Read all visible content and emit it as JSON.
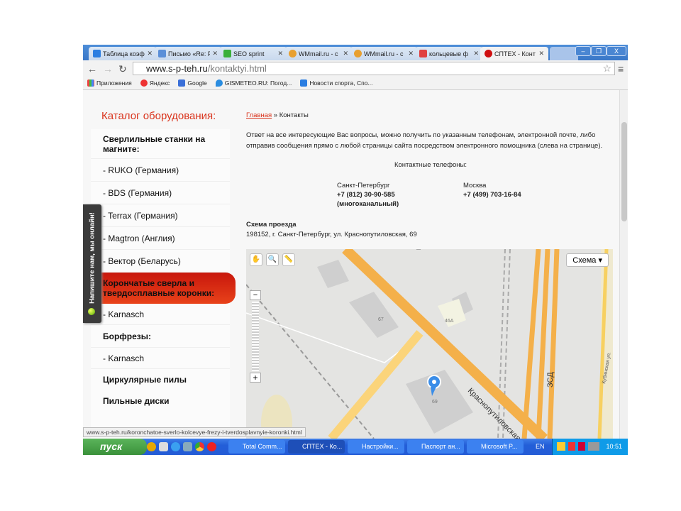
{
  "browser": {
    "tabs": [
      {
        "label": "Таблица коэф",
        "color": "#2a7de1"
      },
      {
        "label": "Письмо «Re: F",
        "color": "#5b8fd8"
      },
      {
        "label": "SEO sprint",
        "color": "#3ab03a"
      },
      {
        "label": "WMmail.ru - с",
        "color": "#e8a030"
      },
      {
        "label": "WMmail.ru - с",
        "color": "#e8a030"
      },
      {
        "label": "кольцевые ф",
        "color": "#e04040"
      },
      {
        "label": "СПТЕХ - Конт",
        "color": "#d01010"
      }
    ],
    "url_domain": "www.s-p-teh.ru",
    "url_path": "/kontaktyi.html",
    "bookmarks": [
      "Приложения",
      "Яндекс",
      "Google",
      "GISMETEO.RU: Погод...",
      "Новости спорта, Спо..."
    ],
    "status_url": "www.s-p-teh.ru/koronchatoe-sverlo-kolcevye-frezy-i-tverdosplavnyie-koronki.html"
  },
  "sidebar": {
    "title": "Каталог оборудования:",
    "items": [
      {
        "label": "Сверлильные станки на магните:"
      },
      {
        "label": "- RUKO (Германия)"
      },
      {
        "label": "- BDS (Германия)"
      },
      {
        "label": "- Terrax (Германия)"
      },
      {
        "label": "- Magtron (Англия)"
      },
      {
        "label": "- Вектор (Беларусь)"
      },
      {
        "label": "Корончатые сверла и твердосплавные коронки:"
      },
      {
        "label": "- Karnasch"
      },
      {
        "label": "Борфрезы:"
      },
      {
        "label": "- Karnasch"
      },
      {
        "label": "Циркулярные пилы"
      },
      {
        "label": "Пильные диски"
      }
    ],
    "chat_label": "Напишите нам, мы онлайн!"
  },
  "main": {
    "breadcrumb_home": "Главная",
    "breadcrumb_sep": " » ",
    "breadcrumb_current": "Контакты",
    "intro": "Ответ на все интересующие Вас вопросы, можно получить по указанным телефонам, электронной почте, либо отправив сообщения прямо с любой страницы сайта посредством электронного помощника (слева на странице).",
    "contacts_title": "Контактные телефоны:",
    "spb_city": "Санкт-Петербург",
    "spb_phone": "+7 (812) 30-90-585",
    "spb_note": "(многоканальный)",
    "msk_city": "Москва",
    "msk_phone": "+7 (499) 703-16-84",
    "scheme_title": "Схема проезда",
    "address": "198152, г. Санкт-Петербург, ул. Краснопутиловская, 69"
  },
  "map": {
    "type_button": "Схема ▾",
    "labels": {
      "b67": "67",
      "b46a": "46А",
      "b69": "69",
      "street1": "Краснопутиловская",
      "street2": "ЗСД",
      "street3": "Кубинская ул."
    }
  },
  "taskbar": {
    "start": "пуск",
    "items": [
      "Total Comm...",
      "СПТЕХ - Ко...",
      "Настройки...",
      "Паспорт ан...",
      "Microsoft P..."
    ],
    "lang": "EN",
    "clock": "10:51"
  }
}
